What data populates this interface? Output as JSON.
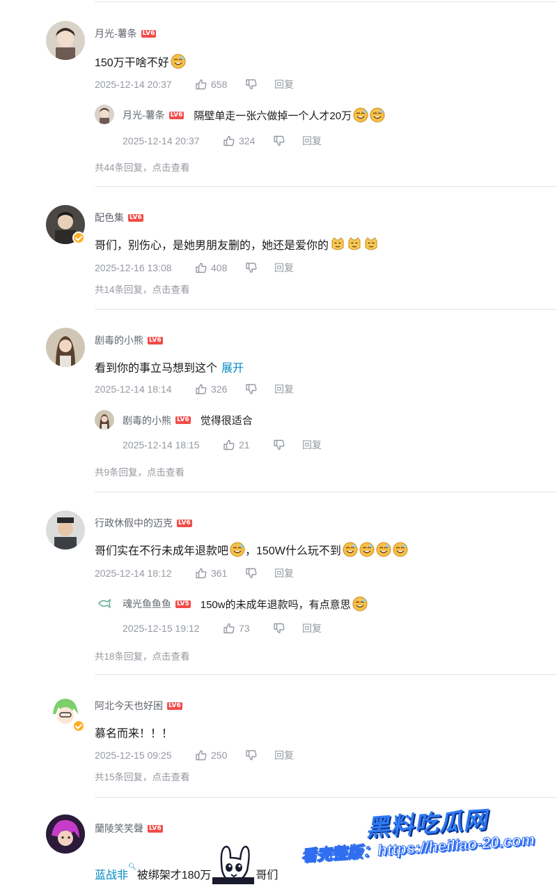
{
  "comments": [
    {
      "user": "月光-薯条",
      "level": "LV6",
      "text": "150万干啥不好",
      "time": "2025-12-14 20:37",
      "likes": "658",
      "reply_label": "回复",
      "sub": {
        "user": "月光-薯条",
        "level": "LV6",
        "text": "隔壁单走一张六做掉一个人才20万",
        "time": "2025-12-14 20:37",
        "likes": "324",
        "reply_label": "回复"
      },
      "more": "共44条回复，点击查看"
    },
    {
      "user": "配色集",
      "level": "LV6",
      "text": "哥们，别伤心，是她男朋友删的，她还是爱你的",
      "time": "2025-12-16 13:08",
      "likes": "408",
      "reply_label": "回复",
      "more": "共14条回复，点击查看"
    },
    {
      "user": "剧毒的小熊",
      "level": "LV6",
      "text": "看到你的事立马想到这个",
      "expand": "展开",
      "time": "2025-12-14 18:14",
      "likes": "326",
      "reply_label": "回复",
      "sub": {
        "user": "剧毒的小熊",
        "level": "LV6",
        "text": "觉得很适合",
        "time": "2025-12-14 18:15",
        "likes": "21",
        "reply_label": "回复"
      },
      "more": "共9条回复，点击查看"
    },
    {
      "user": "行政休假中的迈克",
      "level": "LV6",
      "text_a": "哥们实在不行未成年退款吧",
      "text_b": "，150W什么玩不到",
      "time": "2025-12-14 18:12",
      "likes": "361",
      "reply_label": "回复",
      "sub": {
        "user": "魂光鱼鱼鱼",
        "level": "LV5",
        "text": "150w的未成年退款吗，有点意思",
        "time": "2025-12-15 19:12",
        "likes": "73",
        "reply_label": "回复"
      },
      "more": "共18条回复，点击查看"
    },
    {
      "user": "阿北今天也好困",
      "level": "LV6",
      "text": "慕名而来！！！",
      "time": "2025-12-15 09:25",
      "likes": "250",
      "reply_label": "回复",
      "more": "共15条回复，点击查看"
    },
    {
      "user": "蘭陵笑笑聲",
      "level": "LV6",
      "mention": "蓝战非",
      "text_a": "被绑架才180万",
      "text_b": "哥们"
    }
  ],
  "watermark": {
    "title": "黑料吃瓜网",
    "url": "看完整版：https://heiliao-20.com"
  },
  "colors": {
    "accent": "#008ac5",
    "level_badge": "#f04c49",
    "muted": "#9499a0",
    "name": "#61666d",
    "divider": "#e3e5e7"
  }
}
